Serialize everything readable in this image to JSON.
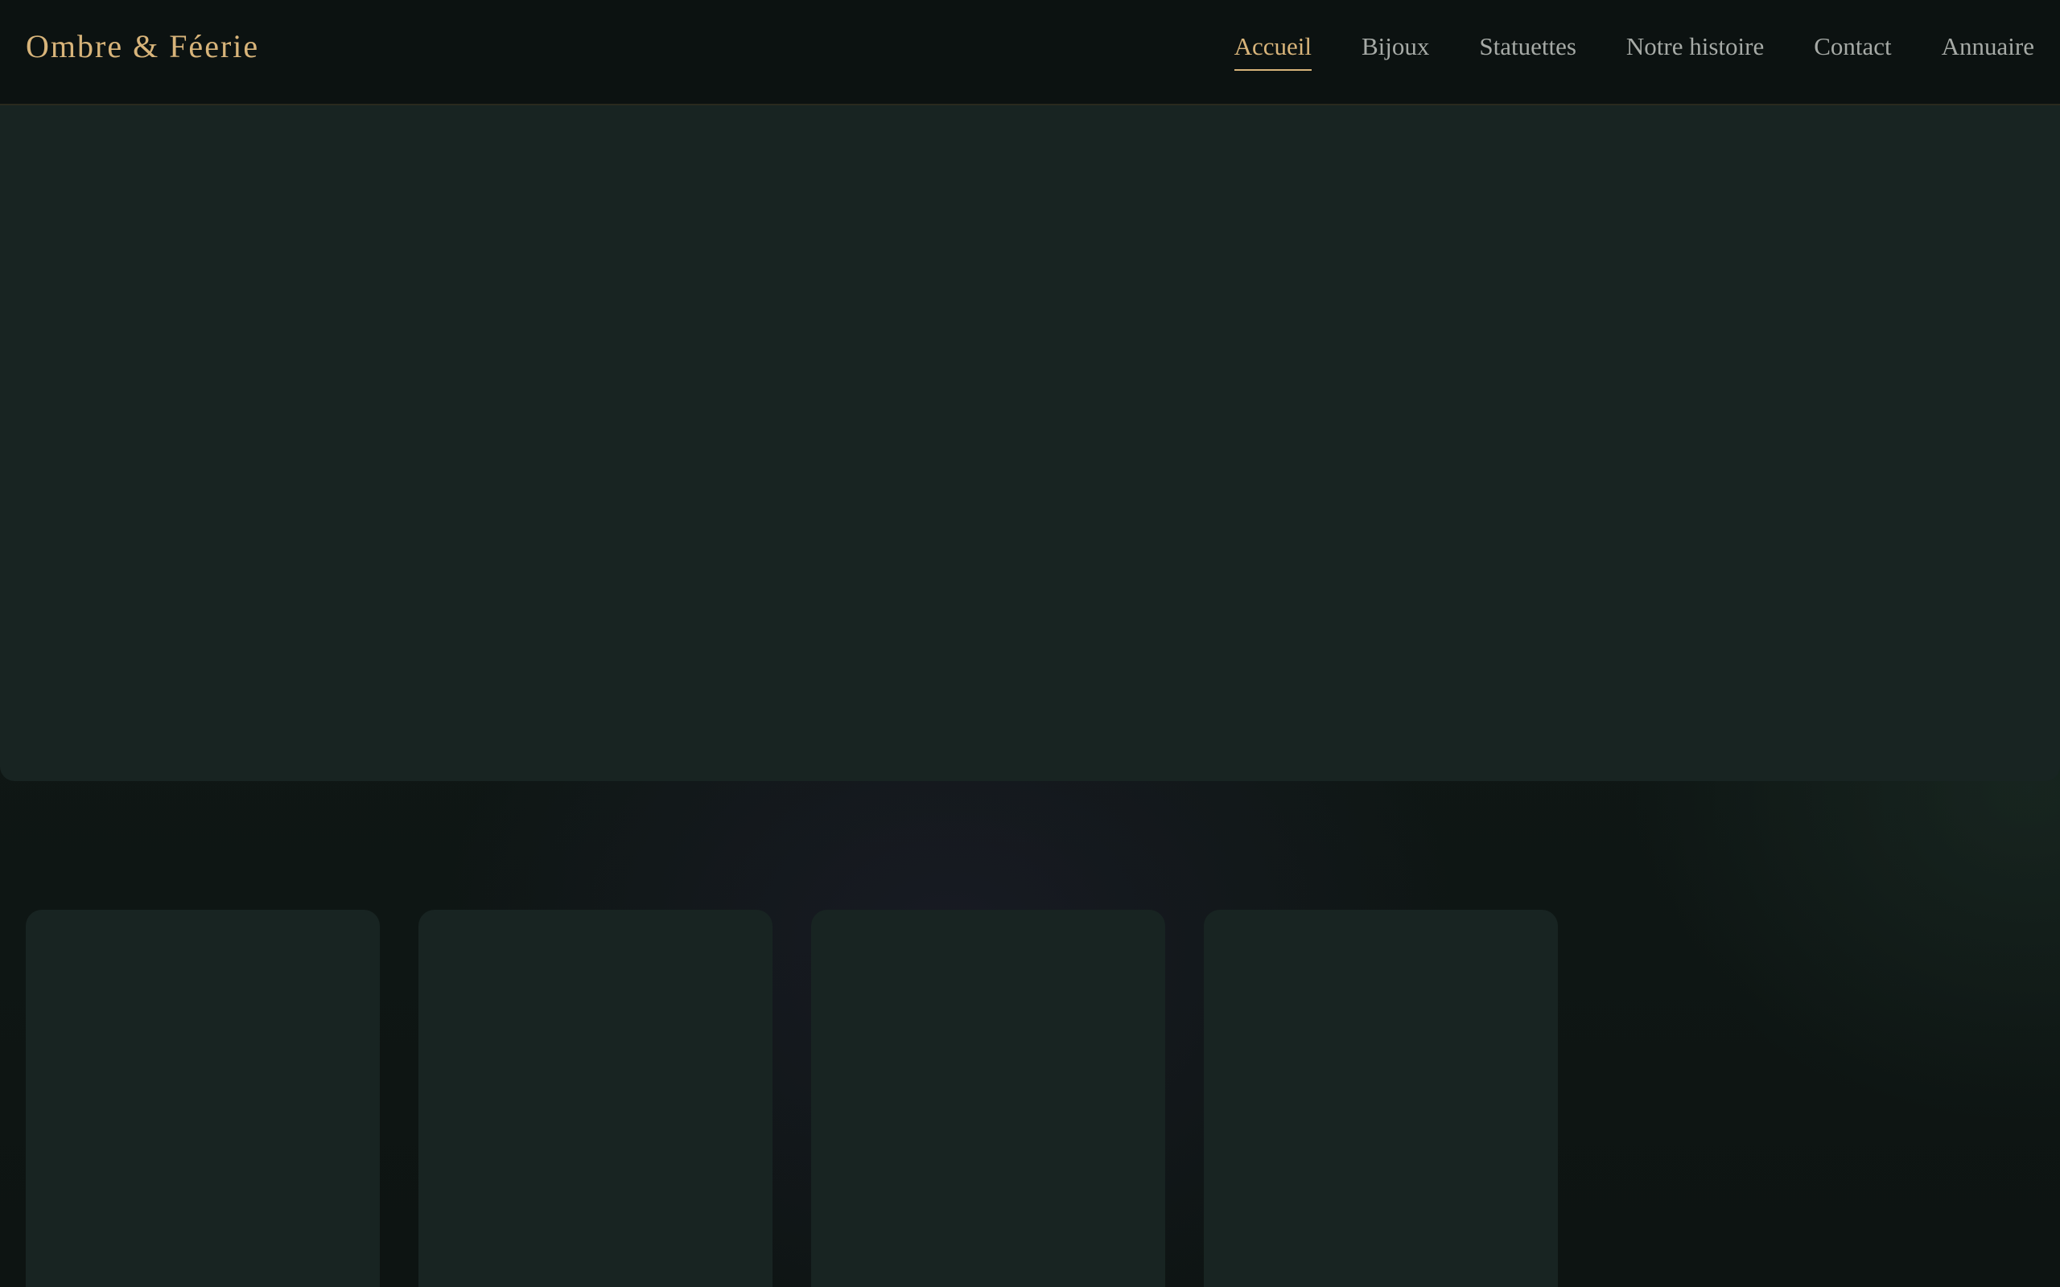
{
  "brand": {
    "name": "Ombre & Féerie"
  },
  "nav": {
    "items": [
      {
        "label": "Accueil",
        "active": true
      },
      {
        "label": "Bijoux",
        "active": false
      },
      {
        "label": "Statuettes",
        "active": false
      },
      {
        "label": "Notre histoire",
        "active": false
      },
      {
        "label": "Contact",
        "active": false
      },
      {
        "label": "Annuaire",
        "active": false
      }
    ]
  },
  "colors": {
    "accent_gold": "#d8b47a",
    "nav_text": "#a6aaa6",
    "header_bg": "#0c1211",
    "panel_bg": "#182422",
    "page_bg": "#0f1614"
  }
}
